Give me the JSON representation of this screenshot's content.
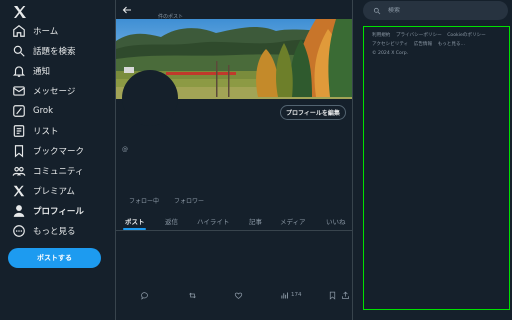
{
  "nav": {
    "items": [
      {
        "label": "ホーム",
        "icon": "home-icon"
      },
      {
        "label": "話題を検索",
        "icon": "search-icon"
      },
      {
        "label": "通知",
        "icon": "bell-icon"
      },
      {
        "label": "メッセージ",
        "icon": "mail-icon"
      },
      {
        "label": "Grok",
        "icon": "grok-icon"
      },
      {
        "label": "リスト",
        "icon": "list-icon"
      },
      {
        "label": "ブックマーク",
        "icon": "bookmark-icon"
      },
      {
        "label": "コミュニティ",
        "icon": "communities-icon"
      },
      {
        "label": "プレミアム",
        "icon": "x-logo-icon"
      },
      {
        "label": "プロフィール",
        "icon": "profile-icon"
      },
      {
        "label": "もっと見る",
        "icon": "more-icon"
      }
    ],
    "post_button": "ポストする",
    "active": "プロフィール"
  },
  "header": {
    "subtitle": "件のポスト"
  },
  "profile": {
    "edit_button": "プロフィールを編集",
    "handle": "@",
    "following_label": "フォロー中",
    "followers_label": "フォロワー"
  },
  "tabs": [
    "ポスト",
    "返信",
    "ハイライト",
    "記事",
    "メディア",
    "いいね"
  ],
  "post_actions": {
    "views_count": "174"
  },
  "search": {
    "placeholder": "検索"
  },
  "footer_links": [
    "利用規約",
    "プライバシーポリシー",
    "Cookieのポリシー",
    "アクセシビリティ",
    "広告情報",
    "もっと見る…",
    "© 2024 X Corp."
  ],
  "colors": {
    "background": "#15202b",
    "accent": "#1d9bf0",
    "highlight_border": "#00e100"
  }
}
